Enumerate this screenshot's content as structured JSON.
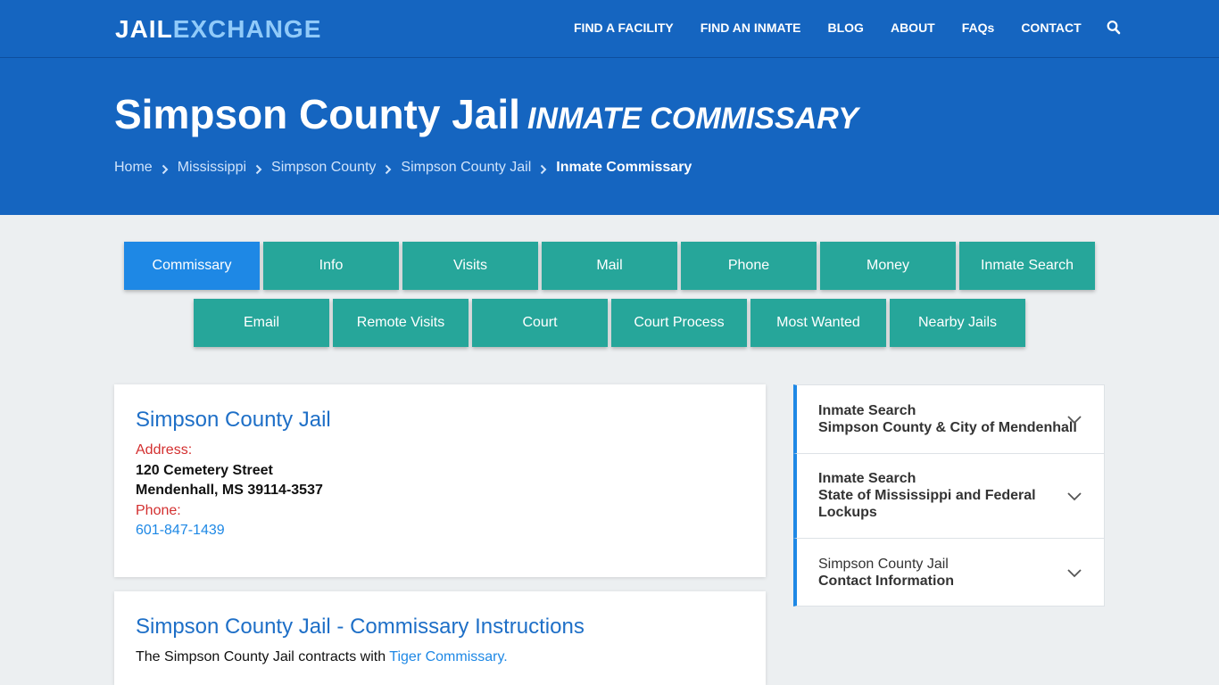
{
  "brand": {
    "logo_part1": "JAIL",
    "logo_part2": "EXCHANGE"
  },
  "nav": {
    "items": [
      "FIND A FACILITY",
      "FIND AN INMATE",
      "BLOG",
      "ABOUT",
      "FAQs",
      "CONTACT"
    ],
    "search_icon": "search-icon"
  },
  "hero": {
    "title": "Simpson County Jail",
    "subtitle": "Inmate Commissary",
    "breadcrumbs": [
      "Home",
      "Mississippi",
      "Simpson County",
      "Simpson County Jail"
    ],
    "breadcrumb_current": "Inmate Commissary"
  },
  "tabs": {
    "row1": [
      "Commissary",
      "Info",
      "Visits",
      "Mail",
      "Phone",
      "Money",
      "Inmate Search"
    ],
    "row2": [
      "Email",
      "Remote Visits",
      "Court",
      "Court Process",
      "Most Wanted",
      "Nearby Jails"
    ],
    "active": "Commissary"
  },
  "facility_card": {
    "title": "Simpson County Jail",
    "address_label": "Address:",
    "address_line1": "120 Cemetery Street",
    "address_line2": "Mendenhall, MS 39114-3537",
    "phone_label": "Phone:",
    "phone": "601-847-1439"
  },
  "instructions_card": {
    "title": "Simpson County Jail - Commissary Instructions",
    "text": "The Simpson County Jail contracts with",
    "link": "Tiger Commissary."
  },
  "sidebar": [
    {
      "line1": "Inmate Search",
      "line2": "Simpson County & City of Mendenhall",
      "line3": ""
    },
    {
      "line1": "Inmate Search",
      "line2": "State of Mississippi and Federal",
      "line3": "Lockups"
    },
    {
      "line1": "Simpson County Jail",
      "line2": "Contact Information",
      "line3": ""
    }
  ],
  "colors": {
    "header_blue": "#1565c0",
    "tab_teal": "#26a69a",
    "tab_active": "#1e88e5",
    "label_red": "#d32f2f",
    "link_blue": "#1e88e5"
  }
}
